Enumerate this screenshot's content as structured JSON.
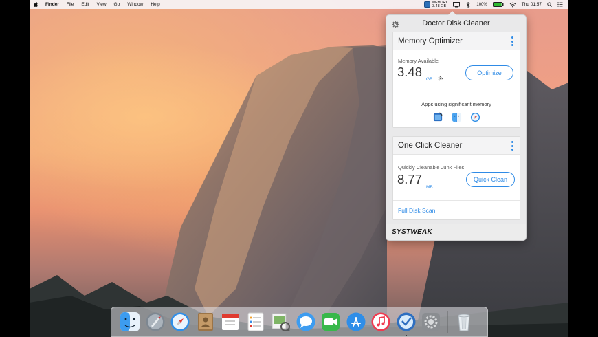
{
  "menubar": {
    "items": [
      "Finder",
      "File",
      "Edit",
      "View",
      "Go",
      "Window",
      "Help"
    ],
    "memory_label": "MEMORY",
    "memory_value": "3.48 GB",
    "battery": "100%",
    "clock": "Thu 01:57"
  },
  "popover": {
    "title": "Doctor Disk Cleaner",
    "memory": {
      "title": "Memory Optimizer",
      "available_label": "Memory Available",
      "value": "3.48",
      "unit": "GB",
      "button": "Optimize",
      "apps_label": "Apps using significant memory"
    },
    "cleaner": {
      "title": "One Click Cleaner",
      "junk_label": "Quickly Cleanable Junk Files",
      "value": "8.77",
      "unit": "MB",
      "button": "Quick Clean",
      "full_scan": "Full Disk Scan"
    },
    "brand": "SYSTWEAK"
  },
  "dock": {
    "icons": [
      "finder-icon",
      "launchpad-icon",
      "safari-icon",
      "contacts-icon",
      "calendar-icon",
      "reminders-icon",
      "preview-icon",
      "messages-icon",
      "facetime-icon",
      "app-store-icon",
      "itunes-icon",
      "doctor-disk-cleaner-icon",
      "system-preferences-icon",
      "trash-icon"
    ]
  },
  "colors": {
    "accent": "#2f8be6"
  }
}
